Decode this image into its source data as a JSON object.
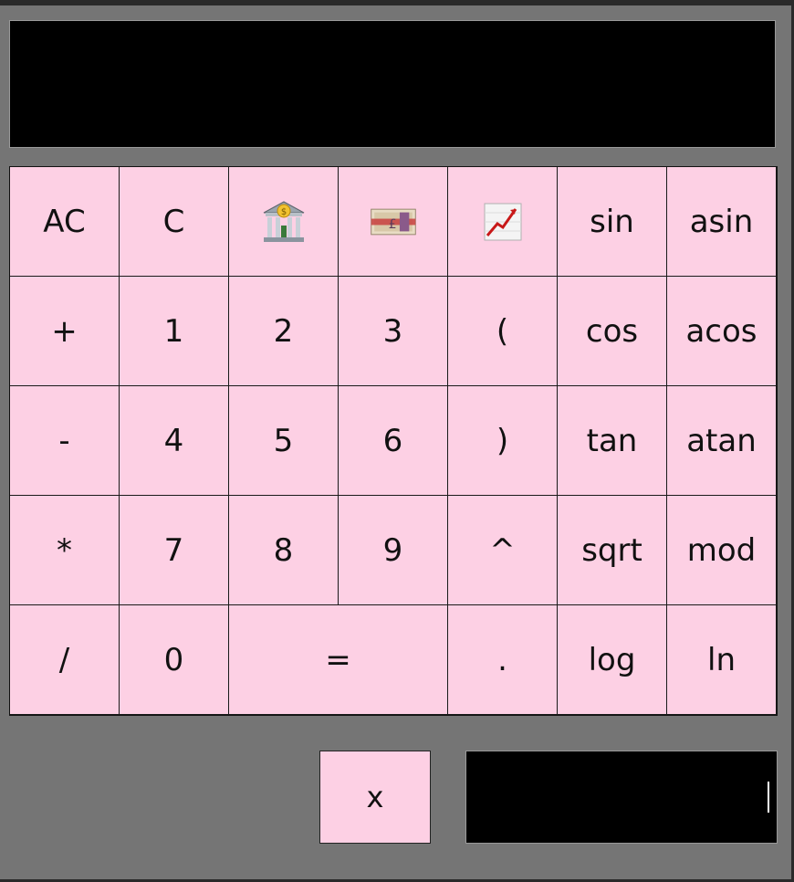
{
  "display": {
    "value": ""
  },
  "keys": [
    [
      "AC",
      "C",
      "bank-icon",
      "pound-banknote-icon",
      "chart-increasing-icon",
      "sin",
      "asin"
    ],
    [
      "+",
      "1",
      "2",
      "3",
      "(",
      "cos",
      "acos"
    ],
    [
      "-",
      "4",
      "5",
      "6",
      ")",
      "tan",
      "atan"
    ],
    [
      "*",
      "7",
      "8",
      "9",
      "^",
      "sqrt",
      "mod"
    ],
    [
      "/",
      "0",
      "=",
      ".",
      "log",
      "ln"
    ]
  ],
  "labels": {
    "ac": "AC",
    "c": "C",
    "sin": "sin",
    "asin": "asin",
    "plus": "+",
    "one": "1",
    "two": "2",
    "three": "3",
    "lparen": "(",
    "cos": "cos",
    "acos": "acos",
    "minus": "-",
    "four": "4",
    "five": "5",
    "six": "6",
    "rparen": ")",
    "tan": "tan",
    "atan": "atan",
    "times": "*",
    "seven": "7",
    "eight": "8",
    "nine": "9",
    "power": "^",
    "sqrt": "sqrt",
    "mod": "mod",
    "divide": "/",
    "zero": "0",
    "equals": "=",
    "dot": ".",
    "log": "log",
    "ln": "ln"
  },
  "icons": {
    "bank": "bank-icon",
    "currency": "pound-banknote-icon",
    "chart": "chart-increasing-icon"
  },
  "colors": {
    "key_background": "#fdd0e4",
    "window_background": "#757575",
    "display_background": "#000000"
  },
  "close_button": {
    "label": "x"
  },
  "secondary_field": {
    "value": ""
  }
}
